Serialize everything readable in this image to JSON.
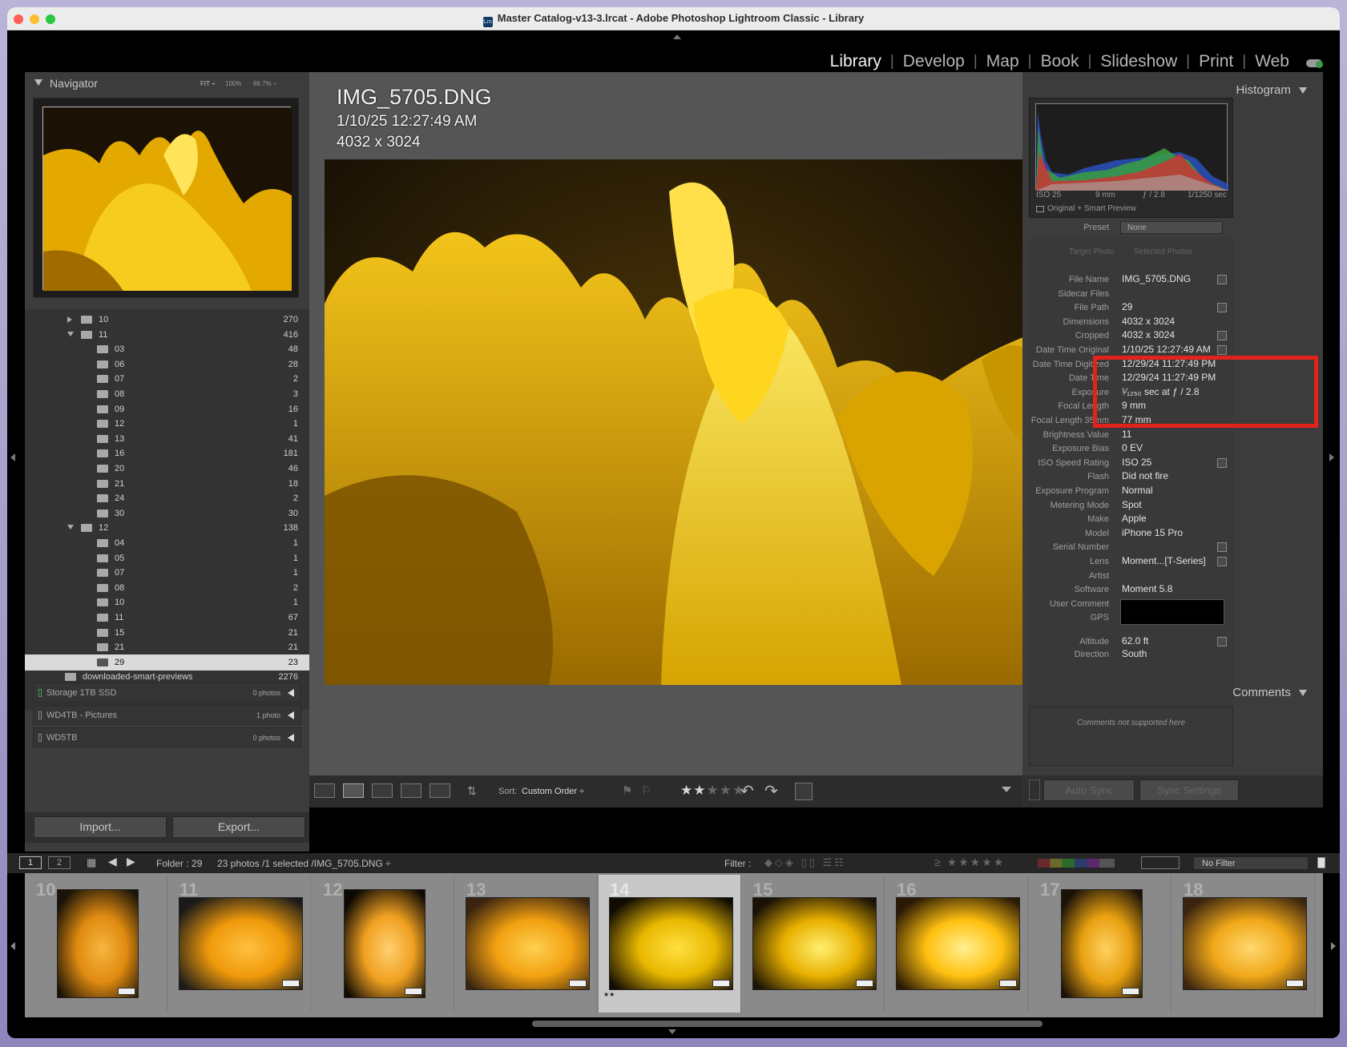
{
  "window": {
    "title": "Master Catalog-v13-3.lrcat - Adobe Photoshop Lightroom Classic - Library",
    "app_badge": "Lrc"
  },
  "modules": [
    {
      "label": "Library",
      "active": true
    },
    {
      "label": "Develop"
    },
    {
      "label": "Map"
    },
    {
      "label": "Book"
    },
    {
      "label": "Slideshow"
    },
    {
      "label": "Print"
    },
    {
      "label": "Web"
    }
  ],
  "navigator": {
    "title": "Navigator",
    "zoom": [
      "FIT ÷",
      "100%",
      "66.7% ÷"
    ]
  },
  "folders": [
    {
      "name": "10",
      "count": "270",
      "level": 1,
      "tri": "right"
    },
    {
      "name": "11",
      "count": "416",
      "level": 1,
      "tri": "down"
    },
    {
      "name": "03",
      "count": "48",
      "level": 2
    },
    {
      "name": "06",
      "count": "28",
      "level": 2
    },
    {
      "name": "07",
      "count": "2",
      "level": 2
    },
    {
      "name": "08",
      "count": "3",
      "level": 2
    },
    {
      "name": "09",
      "count": "16",
      "level": 2
    },
    {
      "name": "12",
      "count": "1",
      "level": 2
    },
    {
      "name": "13",
      "count": "41",
      "level": 2
    },
    {
      "name": "16",
      "count": "181",
      "level": 2
    },
    {
      "name": "20",
      "count": "46",
      "level": 2
    },
    {
      "name": "21",
      "count": "18",
      "level": 2
    },
    {
      "name": "24",
      "count": "2",
      "level": 2
    },
    {
      "name": "30",
      "count": "30",
      "level": 2
    },
    {
      "name": "12",
      "count": "138",
      "level": 1,
      "tri": "down"
    },
    {
      "name": "04",
      "count": "1",
      "level": 2
    },
    {
      "name": "05",
      "count": "1",
      "level": 2
    },
    {
      "name": "07",
      "count": "1",
      "level": 2
    },
    {
      "name": "08",
      "count": "2",
      "level": 2
    },
    {
      "name": "10",
      "count": "1",
      "level": 2
    },
    {
      "name": "11",
      "count": "67",
      "level": 2
    },
    {
      "name": "15",
      "count": "21",
      "level": 2
    },
    {
      "name": "21",
      "count": "21",
      "level": 2
    },
    {
      "name": "29",
      "count": "23",
      "level": 2,
      "selected": true
    },
    {
      "name": "downloaded-smart-previews",
      "count": "2276",
      "level": 0
    }
  ],
  "volumes": [
    {
      "name": "Storage 1TB SSD",
      "count": "0 photos"
    },
    {
      "name": "WD4TB - Pictures",
      "count": "1 photo"
    },
    {
      "name": "WD5TB",
      "count": "0 photos"
    }
  ],
  "left_buttons": {
    "import": "Import...",
    "export": "Export..."
  },
  "image": {
    "filename": "IMG_5705.DNG",
    "datetime": "1/10/25 12:27:49 AM",
    "dimensions": "4032 x 3024"
  },
  "toolbar": {
    "sort_label": "Sort:",
    "sort_value": "Custom Order ÷",
    "rating": 2
  },
  "histogram": {
    "title": "Histogram",
    "iso": "ISO 25",
    "focal": "9 mm",
    "aperture": "ƒ / 2.8",
    "shutter": "1/1250 sec",
    "preview_label": "Original + Smart Preview"
  },
  "metadata": {
    "preset_label": "Preset",
    "preset_value": "None",
    "target_photo": "Target Photo",
    "selected_photos": "Selected Photos",
    "rows": [
      {
        "label": "File Name",
        "value": "IMG_5705.DNG"
      },
      {
        "label": "Sidecar Files",
        "value": ""
      },
      {
        "label": "File Path",
        "value": "29"
      },
      {
        "label": "Dimensions",
        "value": "4032 x 3024"
      },
      {
        "label": "Cropped",
        "value": "4032 x 3024"
      },
      {
        "label": "Date Time Original",
        "value": "1/10/25 12:27:49 AM"
      },
      {
        "label": "Date Time Digitized",
        "value": "12/29/24 11:27:49 PM"
      },
      {
        "label": "Date Time",
        "value": "12/29/24 11:27:49 PM"
      },
      {
        "label": "Exposure",
        "value": "¹⁄₁₂₅₀ sec at ƒ / 2.8"
      },
      {
        "label": "Focal Length",
        "value": "9 mm"
      },
      {
        "label": "Focal Length 35mm",
        "value": "77 mm"
      },
      {
        "label": "Brightness Value",
        "value": "11"
      },
      {
        "label": "Exposure Bias",
        "value": "0 EV"
      },
      {
        "label": "ISO Speed Rating",
        "value": "ISO 25"
      },
      {
        "label": "Flash",
        "value": "Did not fire"
      },
      {
        "label": "Exposure Program",
        "value": "Normal"
      },
      {
        "label": "Metering Mode",
        "value": "Spot"
      },
      {
        "label": "Make",
        "value": "Apple"
      },
      {
        "label": "Model",
        "value": "iPhone 15 Pro"
      },
      {
        "label": "Serial Number",
        "value": ""
      },
      {
        "label": "Lens",
        "value": "Moment...[T-Series]"
      },
      {
        "label": "Artist",
        "value": ""
      },
      {
        "label": "Software",
        "value": "Moment 5.8"
      },
      {
        "label": "User Comment",
        "value": ""
      },
      {
        "label": "GPS",
        "value": ""
      },
      {
        "label": "Altitude",
        "value": "62.0 ft"
      },
      {
        "label": "Direction",
        "value": "South"
      }
    ]
  },
  "comments": {
    "title": "Comments",
    "text": "Comments not supported here"
  },
  "sync": {
    "auto": "Auto Sync",
    "settings": "Sync Settings"
  },
  "filterbar": {
    "page1": "1",
    "page2": "2",
    "folder": "Folder : 29",
    "selection": "23 photos /1 selected /IMG_5705.DNG ÷",
    "filter_label": "Filter :",
    "filter_value": "No Filter"
  },
  "filmstrip": [
    {
      "num": "10"
    },
    {
      "num": "11"
    },
    {
      "num": "12"
    },
    {
      "num": "13"
    },
    {
      "num": "14",
      "selected": true,
      "stars": "★★"
    },
    {
      "num": "15"
    },
    {
      "num": "16"
    },
    {
      "num": "17"
    },
    {
      "num": "18"
    }
  ]
}
